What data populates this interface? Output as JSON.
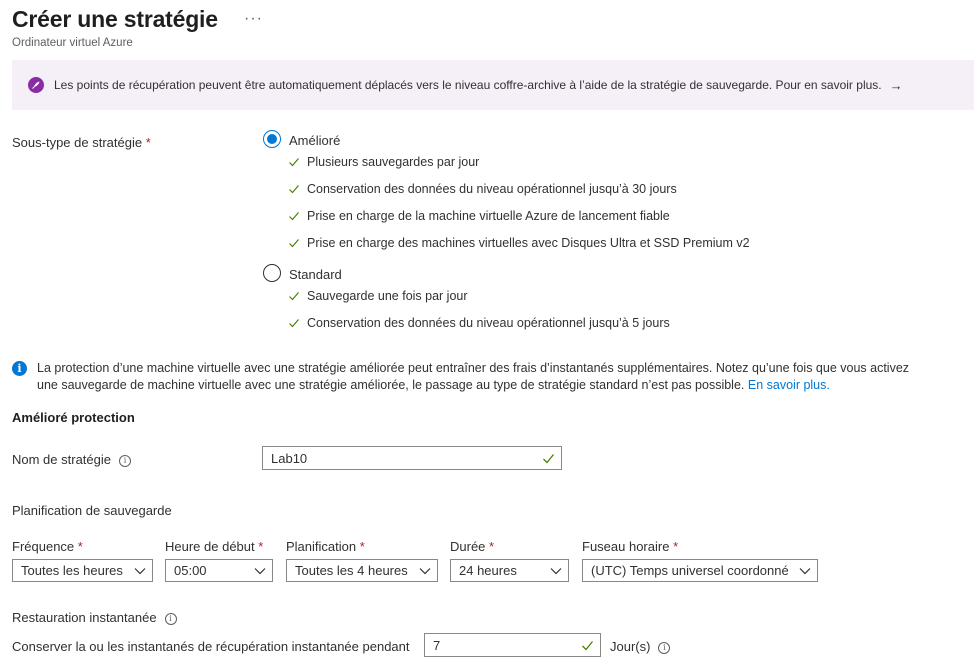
{
  "header": {
    "title": "Créer une stratégie",
    "more": "···",
    "subtitle": "Ordinateur virtuel Azure"
  },
  "banner": {
    "icon": "rocket-icon",
    "text": "Les points de récupération peuvent être automatiquement déplacés vers le niveau coffre-archive à l’aide de la stratégie de sauvegarde. Pour en savoir plus.",
    "arrow": "→",
    "background": "#f5eff8",
    "icon_color": "#8a2da5"
  },
  "policy_subtype": {
    "label": "Sous-type de stratégie",
    "required_mark": "*",
    "options": [
      {
        "label": "Amélioré",
        "selected": true,
        "features": [
          "Plusieurs sauvegardes par jour",
          "Conservation des données du niveau opérationnel jusqu’à 30 jours",
          "Prise en charge de la machine virtuelle Azure de lancement fiable",
          "Prise en charge des machines virtuelles avec Disques Ultra et SSD Premium v2"
        ]
      },
      {
        "label": "Standard",
        "selected": false,
        "features": [
          "Sauvegarde une fois par jour",
          "Conservation des données du niveau opérationnel jusqu’à 5 jours"
        ]
      }
    ]
  },
  "info": {
    "line1": "La protection d’une machine virtuelle avec une stratégie améliorée peut entraîner des frais d’instantanés supplémentaires. Notez qu’une fois que vous activez",
    "line2": "une sauvegarde de machine virtuelle avec une stratégie améliorée, le passage au type de stratégie standard n’est pas possible.",
    "link": "En savoir plus."
  },
  "section_title": "Amélioré protection",
  "policy_name": {
    "label": "Nom de stratégie",
    "value": "Lab10"
  },
  "schedule": {
    "title": "Planification de sauvegarde",
    "fields": [
      {
        "label": "Fréquence",
        "required": "*",
        "value": "Toutes les heures"
      },
      {
        "label": "Heure de début",
        "required": "*",
        "value": "05:00"
      },
      {
        "label": "Planification",
        "required": "*",
        "value": "Toutes les 4 heures"
      },
      {
        "label": "Durée",
        "required": "*",
        "value": "24 heures"
      },
      {
        "label": "Fuseau horaire",
        "required": "*",
        "value": "(UTC) Temps universel coordonné"
      }
    ]
  },
  "instant_restore": {
    "title": "Restauration instantanée",
    "retain_label": "Conserver la ou les instantanés de récupération instantanée pendant",
    "value": "7",
    "unit": "Jour(s)"
  },
  "colors": {
    "accent": "#0078d4",
    "required": "#a4262c",
    "check": "#498205"
  }
}
